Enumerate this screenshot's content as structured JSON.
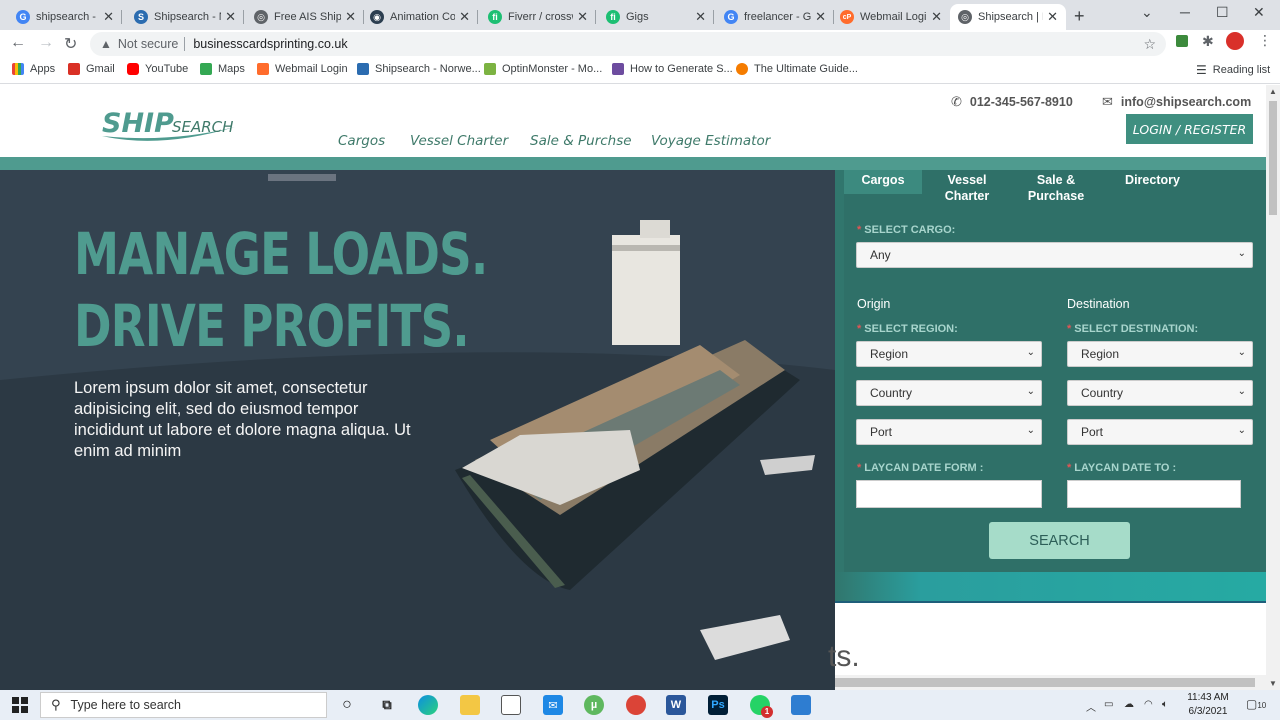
{
  "browser": {
    "tabs": [
      {
        "title": "shipsearch - Go",
        "favicon": "google-icon",
        "color": "#4285f4",
        "letter": "G"
      },
      {
        "title": "Shipsearch - N",
        "favicon": "shipsearch-icon",
        "color": "#2b6cb0",
        "letter": "S"
      },
      {
        "title": "Free AIS Ship T",
        "favicon": "globe-icon",
        "color": "#5f6368",
        "letter": "◎"
      },
      {
        "title": "Animation Cor",
        "favicon": "circle-icon",
        "color": "#2c3e50",
        "letter": "◉"
      },
      {
        "title": "Fiverr / crossw",
        "favicon": "fiverr-icon",
        "color": "#1dbf73",
        "letter": "fi"
      },
      {
        "title": "Gigs",
        "favicon": "fiverr-icon",
        "color": "#1dbf73",
        "letter": "fi"
      },
      {
        "title": "freelancer - Go",
        "favicon": "google-icon",
        "color": "#4285f4",
        "letter": "G"
      },
      {
        "title": "Webmail Login",
        "favicon": "cpanel-icon",
        "color": "#ff6c2c",
        "letter": "cP"
      },
      {
        "title": "Shipsearch | H",
        "favicon": "globe-icon",
        "color": "#5f6368",
        "letter": "◎"
      }
    ],
    "url_warning": "Not secure",
    "url": "businesscardsprinting.co.uk",
    "bookmarks": [
      {
        "label": "Apps",
        "color": "#ea4335"
      },
      {
        "label": "Gmail",
        "color": "#d93025"
      },
      {
        "label": "YouTube",
        "color": "#ff0000"
      },
      {
        "label": "Maps",
        "color": "#34a853"
      },
      {
        "label": "Webmail Login",
        "color": "#ff6c2c"
      },
      {
        "label": "Shipsearch - Norwe...",
        "color": "#2b6cb0"
      },
      {
        "label": "OptinMonster - Mo...",
        "color": "#7cb342"
      },
      {
        "label": "How to Generate S...",
        "color": "#6d4c9f"
      },
      {
        "label": "The Ultimate Guide...",
        "color": "#f57c00"
      }
    ],
    "reading_list": "Reading list"
  },
  "site": {
    "logo_ship": "SHIP",
    "logo_search": "SEARCH",
    "nav": [
      "Cargos",
      "Vessel Charter",
      "Sale & Purchse",
      "Voyage Estimator"
    ],
    "phone": "012-345-567-8910",
    "email": "info@shipsearch.com",
    "login": "LOGIN / REGISTER",
    "hero_line1": "MANAGE LOADS.",
    "hero_line2": "DRIVE PROFITS.",
    "hero_text": "Lorem ipsum dolor sit amet, consectetur adipisicing elit, sed do eiusmod tempor incididunt ut labore et dolore magna aliqua. Ut enim ad minim",
    "panel": {
      "tabs": [
        {
          "label": "Cargos"
        },
        {
          "label": "Vessel Charter"
        },
        {
          "label": "Sale & Purchase"
        },
        {
          "label": "Directory"
        }
      ],
      "select_cargo_label": "SELECT CARGO:",
      "cargo_value": "Any",
      "origin": "Origin",
      "destination": "Destination",
      "select_region_label": "SELECT REGION:",
      "select_destination_label": "SELECT DESTINATION:",
      "region": "Region",
      "country": "Country",
      "port": "Port",
      "laycan_from_label": "LAYCAN DATE FORM :",
      "laycan_to_label": "LAYCAN DATE TO :",
      "laycan_from_value": "",
      "laycan_to_value": "",
      "search": "SEARCH"
    },
    "partial_text": "ts."
  },
  "taskbar": {
    "search_placeholder": "Type here to search",
    "time": "11:43 AM",
    "date": "6/3/2021",
    "notification_count": "10",
    "whatsapp_badge": "1"
  },
  "colors": {
    "brand_teal": "#4f9b8f",
    "panel_teal": "#31766d",
    "search_button": "#a6dcc9"
  }
}
